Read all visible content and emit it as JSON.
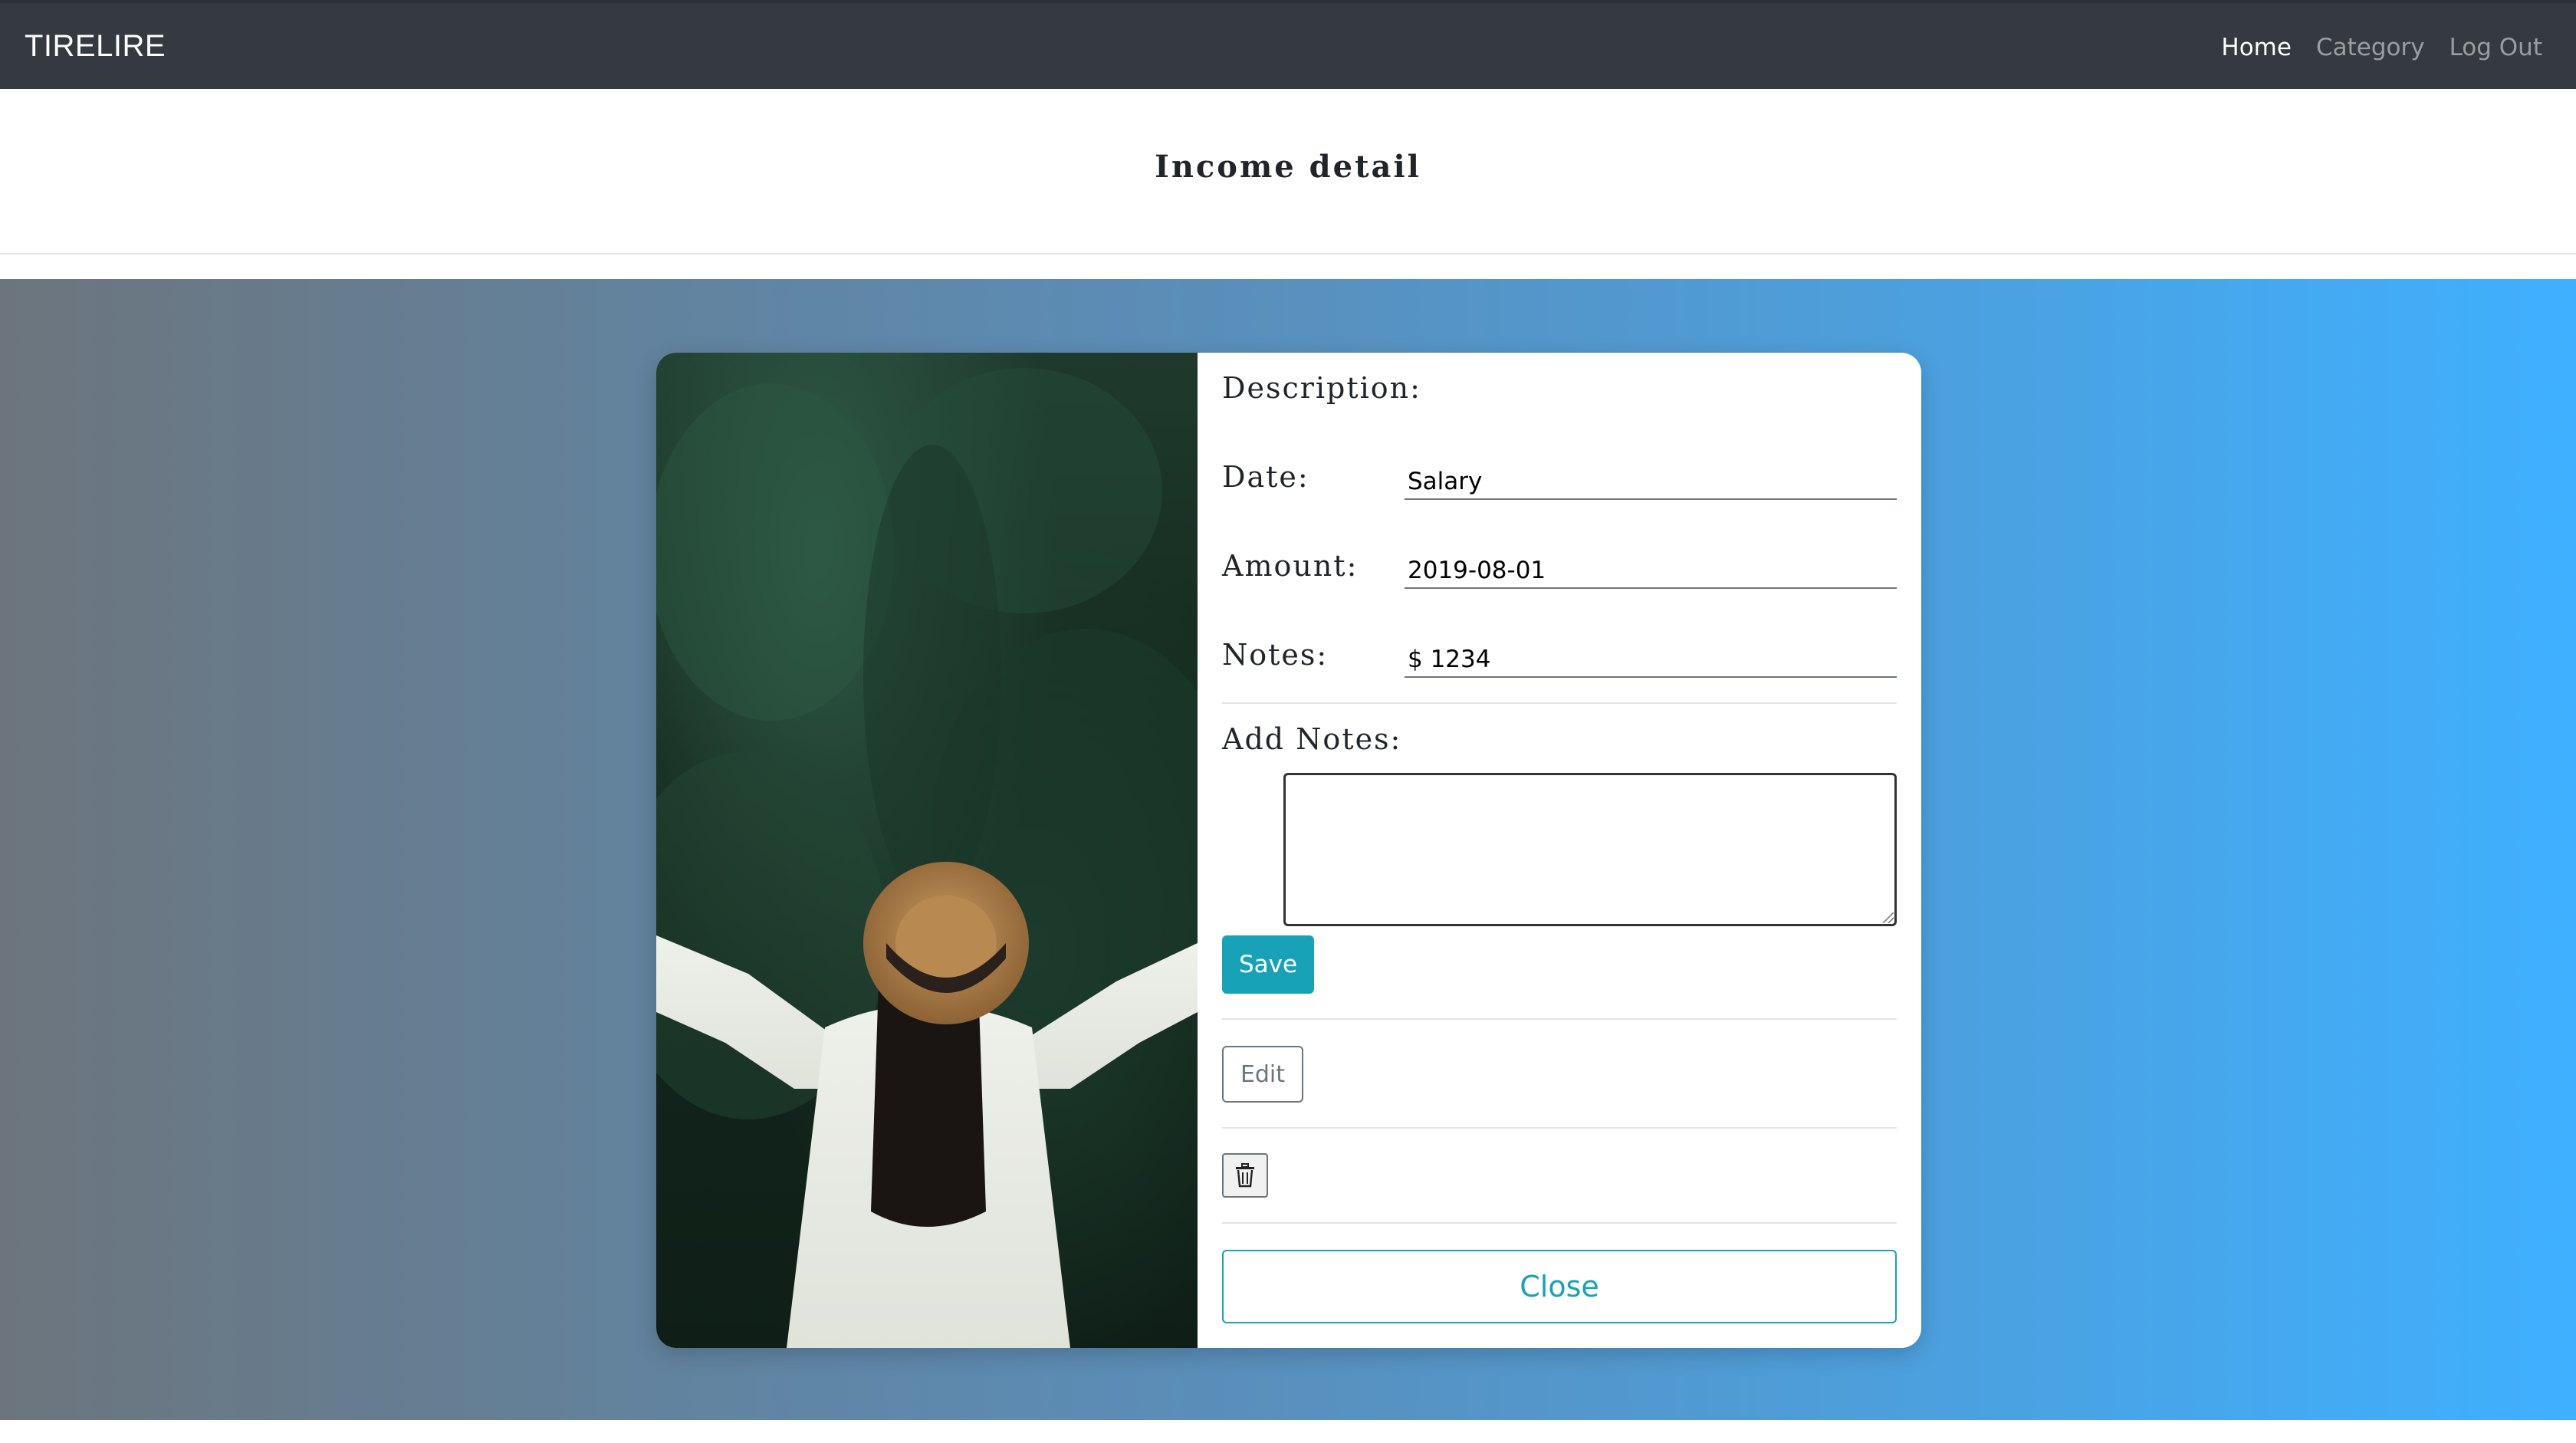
{
  "navbar": {
    "brand": "TIRELIRE",
    "links": [
      {
        "label": "Home",
        "active": true
      },
      {
        "label": "Category",
        "active": false
      },
      {
        "label": "Log Out",
        "active": false
      }
    ]
  },
  "header": {
    "title": "Income detail"
  },
  "colors": {
    "navbar_bg": "#343a40",
    "accent": "#17a2b8",
    "gradient_start": "#6c757d",
    "gradient_end": "#3fb0ff"
  },
  "income": {
    "description_label": "Description:",
    "description_value": "Salary",
    "date_label": "Date:",
    "date_value": "2019-08-01",
    "amount_label": "Amount:",
    "amount_value": "$ 1234",
    "notes_label": "Notes:",
    "add_notes_label": "Add Notes:",
    "add_notes_value": ""
  },
  "actions": {
    "save_label": "Save",
    "edit_label": "Edit",
    "delete_icon": "trash-icon",
    "close_label": "Close"
  },
  "photo": {
    "subject": "photo-woman-hat-forest"
  }
}
